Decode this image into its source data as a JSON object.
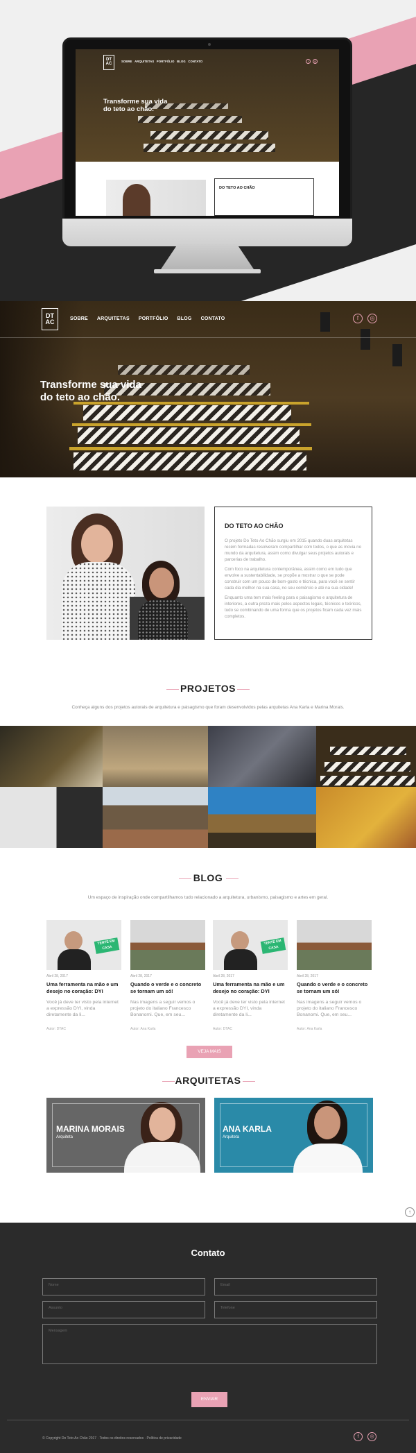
{
  "nav": {
    "logo_top": "DT",
    "logo_bottom": "AC",
    "items": [
      "SOBRE",
      "ARQUITETAS",
      "PORTFÓLIO",
      "BLOG",
      "CONTATO"
    ]
  },
  "hero": {
    "title_line1": "Transforme sua vida",
    "title_line2": "do teto ao chão."
  },
  "about": {
    "title": "DO TETO AO CHÃO",
    "p1": "O projeto Do Teto Ao Chão surgiu em 2015 quando duas arquitetas recém formadas resolveram compartilhar com todos, o que as movia no mundo da arquitetura, assim como divulgar seus projetos autorais e parcerias de trabalho.",
    "p2": "Com foco na arquitetura contemporânea, assim como em tudo que envolve a sustentabilidade, se propõe a mostrar o que se pode construir com um pouco de bom-gosto e técnica, para você se sentir cada dia melhor na sua casa, no seu comércio e até na sua cidade!",
    "p3": "Enquanto uma tem mais feeling para o paisagismo e arquitetura de interiores, a outra preza mais pelos aspectos legais, técnicos e teóricos, tudo se combinando de uma forma que os projetos ficam cada vez mais completos."
  },
  "projects": {
    "title": "PROJETOS",
    "subtitle": "Conheça alguns dos projetos autorais de arquitetura e paisagismo que foram desenvolvidos pelas arquitetas Ana Karla e Marina Morais."
  },
  "blog": {
    "title": "BLOG",
    "subtitle": "Um espaço de inspiração onde compartilhamos tudo relacionado a arquitetura, urbanismo, paisagismo e artes em geral.",
    "badge": "TENTE EM CASA",
    "posts": [
      {
        "date": "Abril 28, 2017",
        "title": "Uma ferramenta na mão e um desejo no coração: DYI",
        "excerpt": "Você já deve ter visto pela internet a expressão DYI, vinda diretamente da li...",
        "author": "Autor: DTAC"
      },
      {
        "date": "Abril 28, 2017",
        "title": "Quando o verde e o concreto se tornam um só!",
        "excerpt": "Nas imagens a seguir vemos o projeto do italiano Francesco Bonanomi. Que, em seu...",
        "author": "Autor: Ana Karla"
      },
      {
        "date": "Abril 28, 2017",
        "title": "Uma ferramenta na mão e um desejo no coração: DYI",
        "excerpt": "Você já deve ter visto pela internet a expressão DYI, vinda diretamente da li...",
        "author": "Autor: DTAC"
      },
      {
        "date": "Abril 28, 2017",
        "title": "Quando o verde e o concreto se tornam um só!",
        "excerpt": "Nas imagens a seguir vemos o projeto do italiano Francesco Bonanomi. Que, em seu...",
        "author": "Autor: Ana Karla"
      }
    ],
    "more": "VEJA MAIS"
  },
  "architects": {
    "title": "ARQUITETAS",
    "items": [
      {
        "name": "MARINA MORAIS",
        "role": "Arquiteta"
      },
      {
        "name": "ANA KARLA",
        "role": "Arquiteta"
      }
    ]
  },
  "contact": {
    "title": "Contato",
    "name_ph": "Nome",
    "email_ph": "Email",
    "subject_ph": "Assunto",
    "phone_ph": "Telefone",
    "message_ph": "Mensagem",
    "submit": "ENVIAR"
  },
  "footer": {
    "copyright": "© Copyright Do Teto Ao Chão 2017 · Todos os direitos reservados · Política de privacidade"
  },
  "icons": {
    "facebook": "f",
    "instagram": "◎",
    "scroll": "↑"
  },
  "colors": {
    "accent": "#e9a2b4",
    "dark": "#2b2b2b"
  }
}
